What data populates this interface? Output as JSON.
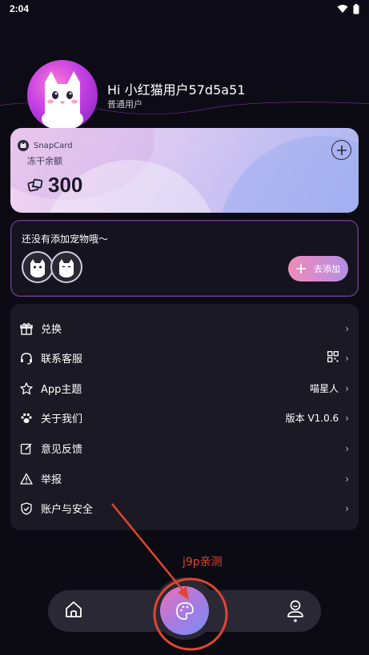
{
  "status_bar": {
    "time": "2:04"
  },
  "profile": {
    "greeting": "Hi 小红猫用户57d5a51",
    "tier": "普通用户"
  },
  "snapcard": {
    "brand": "SnapCard",
    "freeze_label": "冻干余额",
    "balance": "300"
  },
  "pet": {
    "prompt": "还没有添加宠物哦〜",
    "add_label": "去添加"
  },
  "menu": {
    "items": [
      {
        "label": "兑换",
        "value": "",
        "icon": "gift-icon"
      },
      {
        "label": "联系客服",
        "value": "",
        "icon": "headset-icon"
      },
      {
        "label": "App主题",
        "value": "喵星人",
        "icon": "star-badge-icon"
      },
      {
        "label": "关于我们",
        "value": "版本 V1.0.6",
        "icon": "paw-icon"
      },
      {
        "label": "意见反馈",
        "value": "",
        "icon": "edit-icon"
      },
      {
        "label": "举报",
        "value": "",
        "icon": "warning-icon"
      },
      {
        "label": "账户与安全",
        "value": "",
        "icon": "shield-icon"
      }
    ]
  },
  "annotation": {
    "text": "j9p亲测"
  },
  "colors": {
    "background": "#0c0b14",
    "card": "#1b1a24",
    "accent_pink": "#f18ab7",
    "accent_purple": "#a27ce4",
    "annotation_red": "#e2452e"
  }
}
